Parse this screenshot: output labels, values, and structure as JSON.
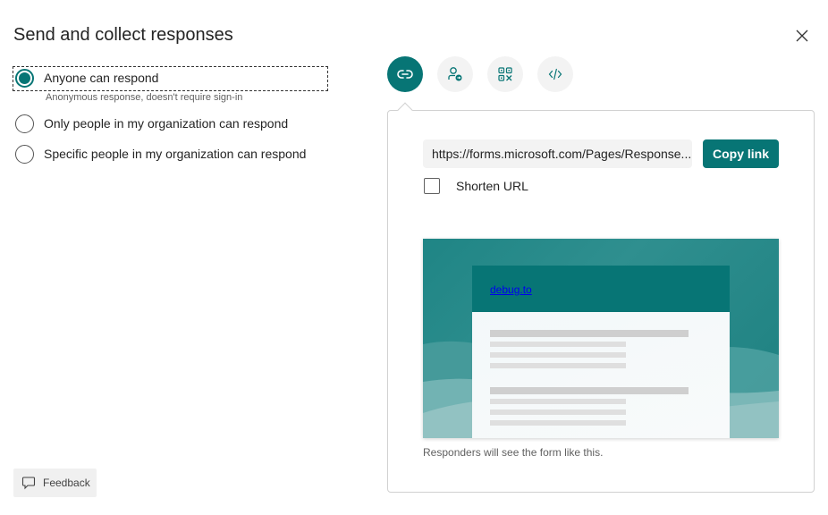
{
  "dialog": {
    "title": "Send and collect responses",
    "close_icon": "close-icon"
  },
  "audience": {
    "options": [
      {
        "label": "Anyone can respond",
        "sublabel": "Anonymous response, doesn't require sign-in",
        "selected": true
      },
      {
        "label": "Only people in my organization can respond",
        "selected": false
      },
      {
        "label": "Specific people in my organization can respond",
        "selected": false
      }
    ]
  },
  "share_tabs": [
    {
      "name": "link",
      "icon": "link-icon",
      "active": true
    },
    {
      "name": "invite",
      "icon": "person-send-icon",
      "active": false
    },
    {
      "name": "qr-code",
      "icon": "qr-code-icon",
      "active": false
    },
    {
      "name": "embed",
      "icon": "code-icon",
      "active": false
    }
  ],
  "link_panel": {
    "url": "https://forms.microsoft.com/Pages/Response...",
    "copy_label": "Copy link",
    "shorten_label": "Shorten URL",
    "shorten_checked": false,
    "preview": {
      "form_title": "debug.to",
      "caption": "Responders will see the form like this."
    }
  },
  "feedback": {
    "label": "Feedback",
    "icon": "comment-icon"
  },
  "colors": {
    "accent": "#077575",
    "tab_bg": "#f3f3f3",
    "text": "#242424",
    "subtext": "#616161"
  }
}
